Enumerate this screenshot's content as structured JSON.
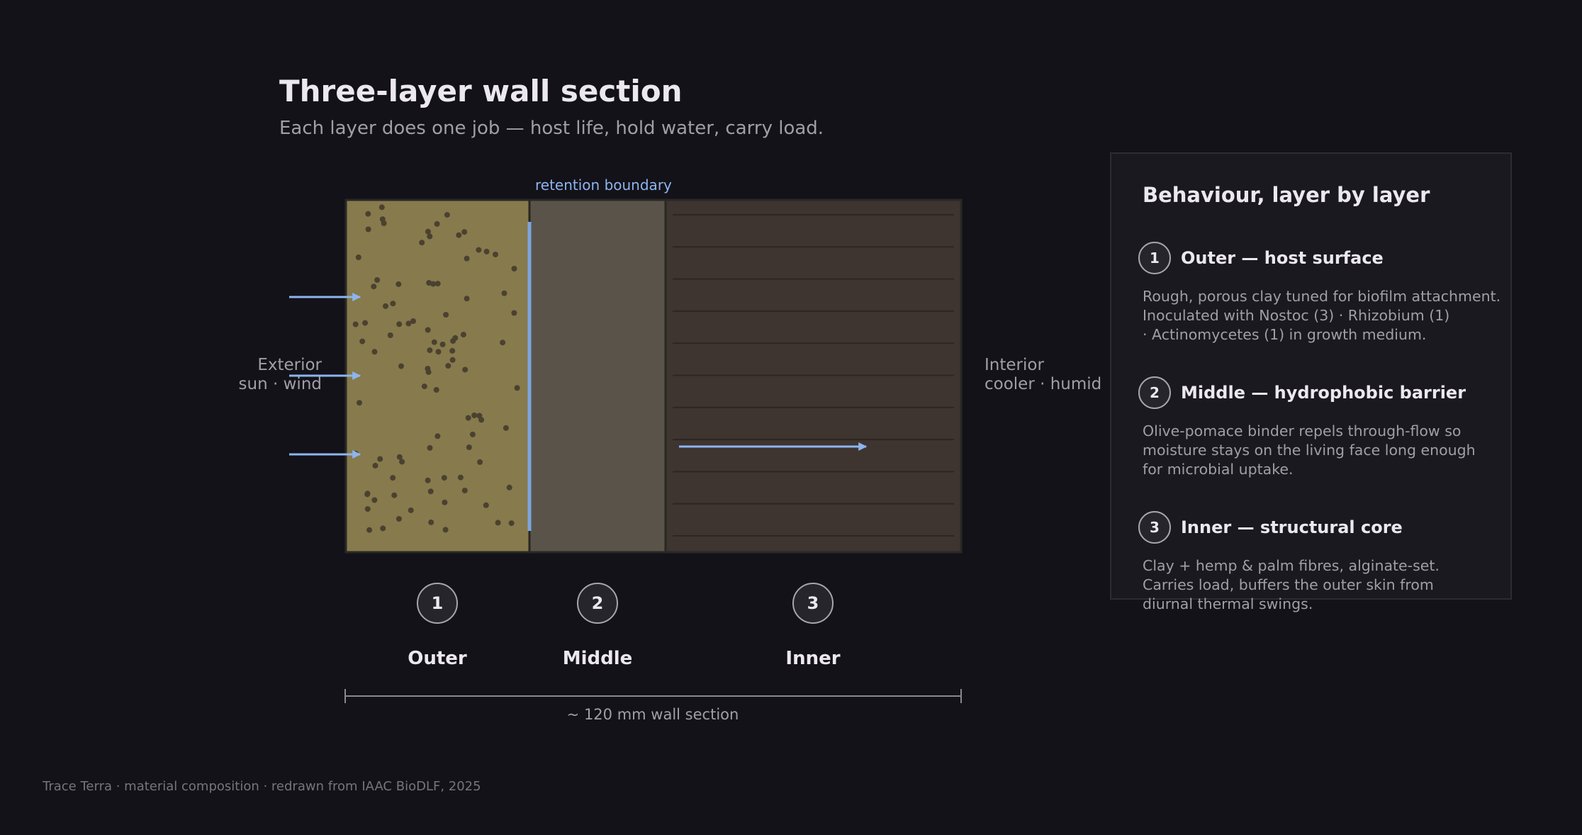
{
  "title": "Three-layer wall section",
  "subtitle": "Each layer does one job — host life, hold water, carry load.",
  "diagram": {
    "retention_label": "retention boundary",
    "exterior_label": [
      "Exterior",
      "sun · wind"
    ],
    "interior_label": [
      "Interior",
      "cooler · humid"
    ],
    "width_label": "~ 120 mm wall section",
    "layers": [
      {
        "number": "1",
        "name": "Outer",
        "color": "#877a4c"
      },
      {
        "number": "2",
        "name": "Middle",
        "color": "#5a5349"
      },
      {
        "number": "3",
        "name": "Inner",
        "color": "#3e3530"
      }
    ],
    "arrow_color": "#8db4ef",
    "boundary_color": "#7ba6e0"
  },
  "legend": {
    "title": "Behaviour, layer by layer",
    "items": [
      {
        "number": "1",
        "heading": "Outer  —  host surface",
        "description": [
          "Rough, porous clay tuned for biofilm attachment.",
          "Inoculated with Nostoc (3) · Rhizobium (1)",
          "· Actinomycetes (1) in growth medium."
        ]
      },
      {
        "number": "2",
        "heading": "Middle  —  hydrophobic barrier",
        "description": [
          "Olive-pomace binder repels through-flow so",
          "moisture stays on the living face long enough",
          "for microbial uptake."
        ]
      },
      {
        "number": "3",
        "heading": "Inner  —  structural core",
        "description": [
          "Clay + hemp & palm fibres, alginate-set.",
          "Carries load, buffers the outer skin from",
          "diurnal thermal swings."
        ]
      }
    ]
  },
  "footer": "Trace Terra · material composition · redrawn from IAAC BioDLF, 2025"
}
